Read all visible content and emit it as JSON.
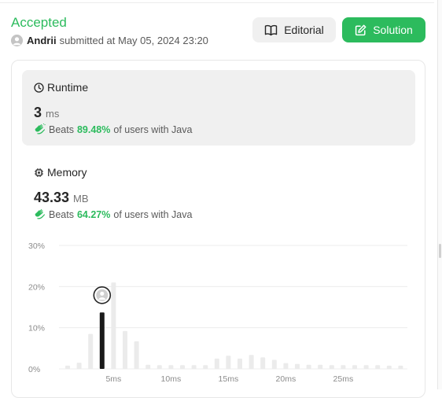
{
  "submission": {
    "status": "Accepted",
    "user": "Andrii",
    "submitted_text": "submitted at May 05, 2024 23:20"
  },
  "buttons": {
    "editorial_label": "Editorial",
    "solution_label": "Solution"
  },
  "runtime": {
    "title": "Runtime",
    "value": "3",
    "unit": "ms",
    "beats_label": "Beats",
    "beats_pct": "89.48%",
    "beats_suffix": "of users with Java"
  },
  "memory": {
    "title": "Memory",
    "value": "43.33",
    "unit": "MB",
    "beats_label": "Beats",
    "beats_pct": "64.27%",
    "beats_suffix": "of users with Java"
  },
  "colors": {
    "accent_green": "#2cbb5d",
    "bar_gray": "#ebebeb",
    "bar_selected": "#1a1a1a"
  },
  "chart_data": {
    "type": "bar",
    "ylim": [
      0,
      30
    ],
    "yticks": [
      "0%",
      "10%",
      "20%",
      "30%"
    ],
    "ytick_values": [
      0,
      10,
      20,
      30
    ],
    "xticks": [
      "5ms",
      "10ms",
      "15ms",
      "20ms",
      "25ms"
    ],
    "xtick_values": [
      5,
      10,
      15,
      20,
      25
    ],
    "x": [
      0,
      1,
      2,
      3,
      4,
      5,
      6,
      7,
      8,
      9,
      10,
      11,
      12,
      13,
      14,
      15,
      16,
      17,
      18,
      19,
      20,
      21,
      22,
      23,
      24,
      25,
      26,
      27,
      28,
      29
    ],
    "values": [
      0.8,
      1.5,
      8.5,
      13.7,
      21.0,
      9.2,
      6.7,
      1.0,
      0.9,
      0.9,
      0.9,
      0.9,
      0.9,
      2.5,
      3.2,
      2.5,
      3.4,
      2.8,
      2.2,
      1.4,
      1.2,
      1.0,
      1.0,
      0.9,
      0.9,
      0.9,
      0.9,
      0.9,
      0.8,
      0.8
    ],
    "selected_x": 3,
    "grid": true
  }
}
